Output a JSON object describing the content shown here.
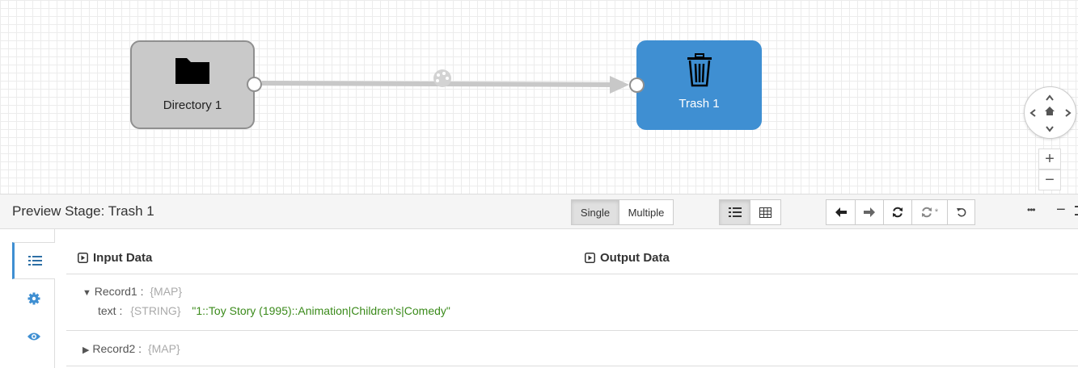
{
  "canvas": {
    "source_stage": {
      "label": "Directory 1",
      "icon": "folder-icon"
    },
    "target_stage": {
      "label": "Trash 1",
      "icon": "trash-icon"
    },
    "connection_icon": "data-rules-icon",
    "nav": {
      "up": "⌃",
      "down": "⌄",
      "left": "‹",
      "right": "›",
      "home": "⌂"
    },
    "zoom_in": "+",
    "zoom_out": "−"
  },
  "preview": {
    "title": "Preview Stage: Trash 1",
    "mode_single": "Single",
    "mode_multiple": "Multiple",
    "refresh_star": "*",
    "more": "•••",
    "minimize": "−"
  },
  "data": {
    "input_header": "Input Data",
    "output_header": "Output Data",
    "records": [
      {
        "name": "Record1 :",
        "type": "{MAP}",
        "expanded": true,
        "fields": [
          {
            "key": "text :",
            "type": "{STRING}",
            "value": "\"1::Toy Story (1995)::Animation|Children's|Comedy\""
          }
        ]
      },
      {
        "name": "Record2 :",
        "type": "{MAP}",
        "expanded": false
      }
    ]
  },
  "colors": {
    "accent": "#3f8fd2",
    "source_node": "#c9c9c9",
    "value_text": "#3a8a1a"
  }
}
